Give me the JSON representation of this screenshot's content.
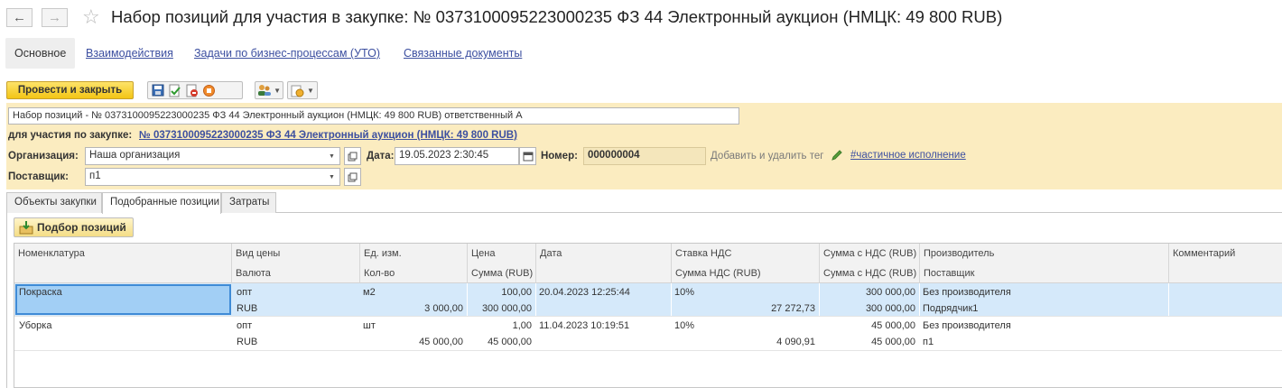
{
  "window": {
    "title": "Набор позиций для участия в закупке: № 0373100095223000235 ФЗ 44 Электронный аукцион (НМЦК: 49 800 RUB)",
    "back_icon": "arrow-left",
    "forward_icon": "arrow-right",
    "favorite_icon": "star"
  },
  "top_tabs": [
    {
      "label": "Основное"
    },
    {
      "label": "Взаимодействия"
    },
    {
      "label": "Задачи по бизнес-процессам (УТО)"
    },
    {
      "label": "Связанные документы"
    }
  ],
  "toolbar": {
    "post_close_label": "Провести и закрыть"
  },
  "header": {
    "description": "Набор позиций -  № 0373100095223000235 ФЗ 44 Электронный аукцион (НМЦК: 49 800 RUB) ответственный  А",
    "purchase_label": "для участия по закупке:",
    "purchase_link": "№ 0373100095223000235 ФЗ 44 Электронный аукцион (НМЦК: 49 800 RUB)",
    "org_label": "Организация:",
    "org_value": "Наша организация",
    "date_label": "Дата:",
    "date_value": "19.05.2023  2:30:45",
    "number_label": "Номер:",
    "number_value": "000000004",
    "tag_hint": "Добавить и удалить тег",
    "tag_link": "#частичное исполнение",
    "supplier_label": "Поставщик:",
    "supplier_value": "п1"
  },
  "inner_tabs": [
    {
      "label": "Объекты закупки"
    },
    {
      "label": "Подобранные позиции"
    },
    {
      "label": "Затраты"
    }
  ],
  "pick_button_label": "Подбор позиций",
  "table": {
    "headers_top": [
      "Номенклатура",
      "Вид цены",
      "Ед. изм.",
      "Цена",
      "Дата",
      "Ставка НДС",
      "Сумма с НДС (RUB)",
      "Производитель",
      "Комментарий"
    ],
    "headers_bottom": [
      "Валюта",
      "Кол-во",
      "Сумма (RUB)",
      "Сумма НДС (RUB)",
      "Сумма с НДС (RUB)",
      "Поставщик"
    ],
    "rows": [
      {
        "name": "Покраска",
        "price_type": "опт",
        "unit": "м2",
        "price": "100,00",
        "date": "20.04.2023 12:25:44",
        "vat_rate": "10%",
        "sum_vat_total": "300 000,00",
        "manufacturer": "Без производителя",
        "currency": "RUB",
        "qty": "3 000,00",
        "sum": "300 000,00",
        "vat_sum": "27 272,73",
        "sum_vat_total2": "300 000,00",
        "supplier": "Подрядчик1"
      },
      {
        "name": "Уборка",
        "price_type": "опт",
        "unit": "шт",
        "price": "1,00",
        "date": "11.04.2023 10:19:51",
        "vat_rate": "10%",
        "sum_vat_total": "45 000,00",
        "manufacturer": "Без производителя",
        "currency": "RUB",
        "qty": "45 000,00",
        "sum": "45 000,00",
        "vat_sum": "4 090,91",
        "sum_vat_total2": "45 000,00",
        "supplier": "п1"
      }
    ]
  },
  "colors": {
    "accent_yellow": "#f3c515",
    "form_background": "#fbecc0",
    "link": "#3c4fa0",
    "selected_row": "#d5e9fa",
    "focused_cell": "#a2cff5"
  }
}
